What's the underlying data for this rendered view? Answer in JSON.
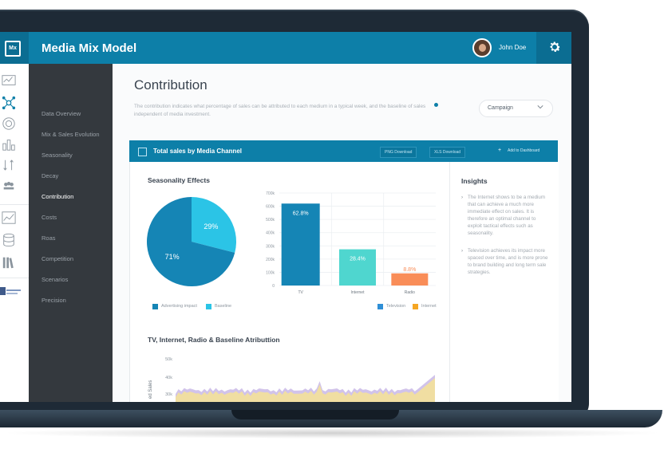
{
  "app": {
    "title": "Media Mix Model",
    "logo": "Mx",
    "user_name": "John Doe"
  },
  "sidebar": {
    "items": [
      {
        "label": "Data Overview"
      },
      {
        "label": "Mix & Sales Evolution"
      },
      {
        "label": "Seasonality"
      },
      {
        "label": "Decay"
      },
      {
        "label": "Contribution",
        "active": true
      },
      {
        "label": "Costs"
      },
      {
        "label": "Roas"
      },
      {
        "label": "Competition"
      },
      {
        "label": "Scenarios"
      },
      {
        "label": "Precision"
      }
    ]
  },
  "page": {
    "title": "Contribution",
    "description": "The contribution indicates what percentage of sales can be attributed to each medium in a typical week, and the baseline of sales independent of media investment.",
    "select_value": "Campaign"
  },
  "card": {
    "title": "Total sales by Media Channel",
    "btn_png": "PNG Download",
    "btn_xls": "XLS Download",
    "btn_add": "Add to Dashboard"
  },
  "seasonality": {
    "title": "Seasonality Effects",
    "legend": [
      "Advertising impact",
      "Baseline"
    ]
  },
  "channels_legend": [
    "Television",
    "Internet"
  ],
  "insights": {
    "title": "Insights",
    "items": [
      "The Internet shows to be a medium that can achieve a much more immediate effect on sales. It is therefore an optimal channel to exploit tactical effects such as seasonality.",
      "Television achieves its impact more spaced over time, and is more prone to brand building and long term sale strategies."
    ]
  },
  "attribution": {
    "title": "TV, Internet, Radio & Baseline Atributtion",
    "ylabel": "ed Sales"
  },
  "colors": {
    "primary": "#0d7fa8",
    "tv": "#1585b5",
    "internet": "#4fd6cf",
    "radio": "#f98d58",
    "baseline": "#2bc4e6",
    "television_legend": "#2f8fd6",
    "internet_legend": "#f5a623"
  },
  "chart_data": [
    {
      "type": "pie",
      "labels": [
        "Advertising impact",
        "Baseline"
      ],
      "values": [
        71,
        29
      ],
      "data_labels": [
        "71%",
        "29%"
      ]
    },
    {
      "type": "bar",
      "categories": [
        "TV",
        "Internet",
        "Radio"
      ],
      "values": [
        620000,
        274000,
        92000
      ],
      "data_labels": [
        "62.8%",
        "28.4%",
        "8.8%"
      ],
      "yticks": [
        "0",
        "100k",
        "200k",
        "300k",
        "400k",
        "500k",
        "600k",
        "700k"
      ],
      "ylim": [
        0,
        700000
      ],
      "grid": true,
      "legend": [
        "Television",
        "Internet"
      ]
    },
    {
      "type": "area",
      "yticks": [
        "30k",
        "40k",
        "50k"
      ],
      "ylabel": "ed Sales"
    }
  ]
}
